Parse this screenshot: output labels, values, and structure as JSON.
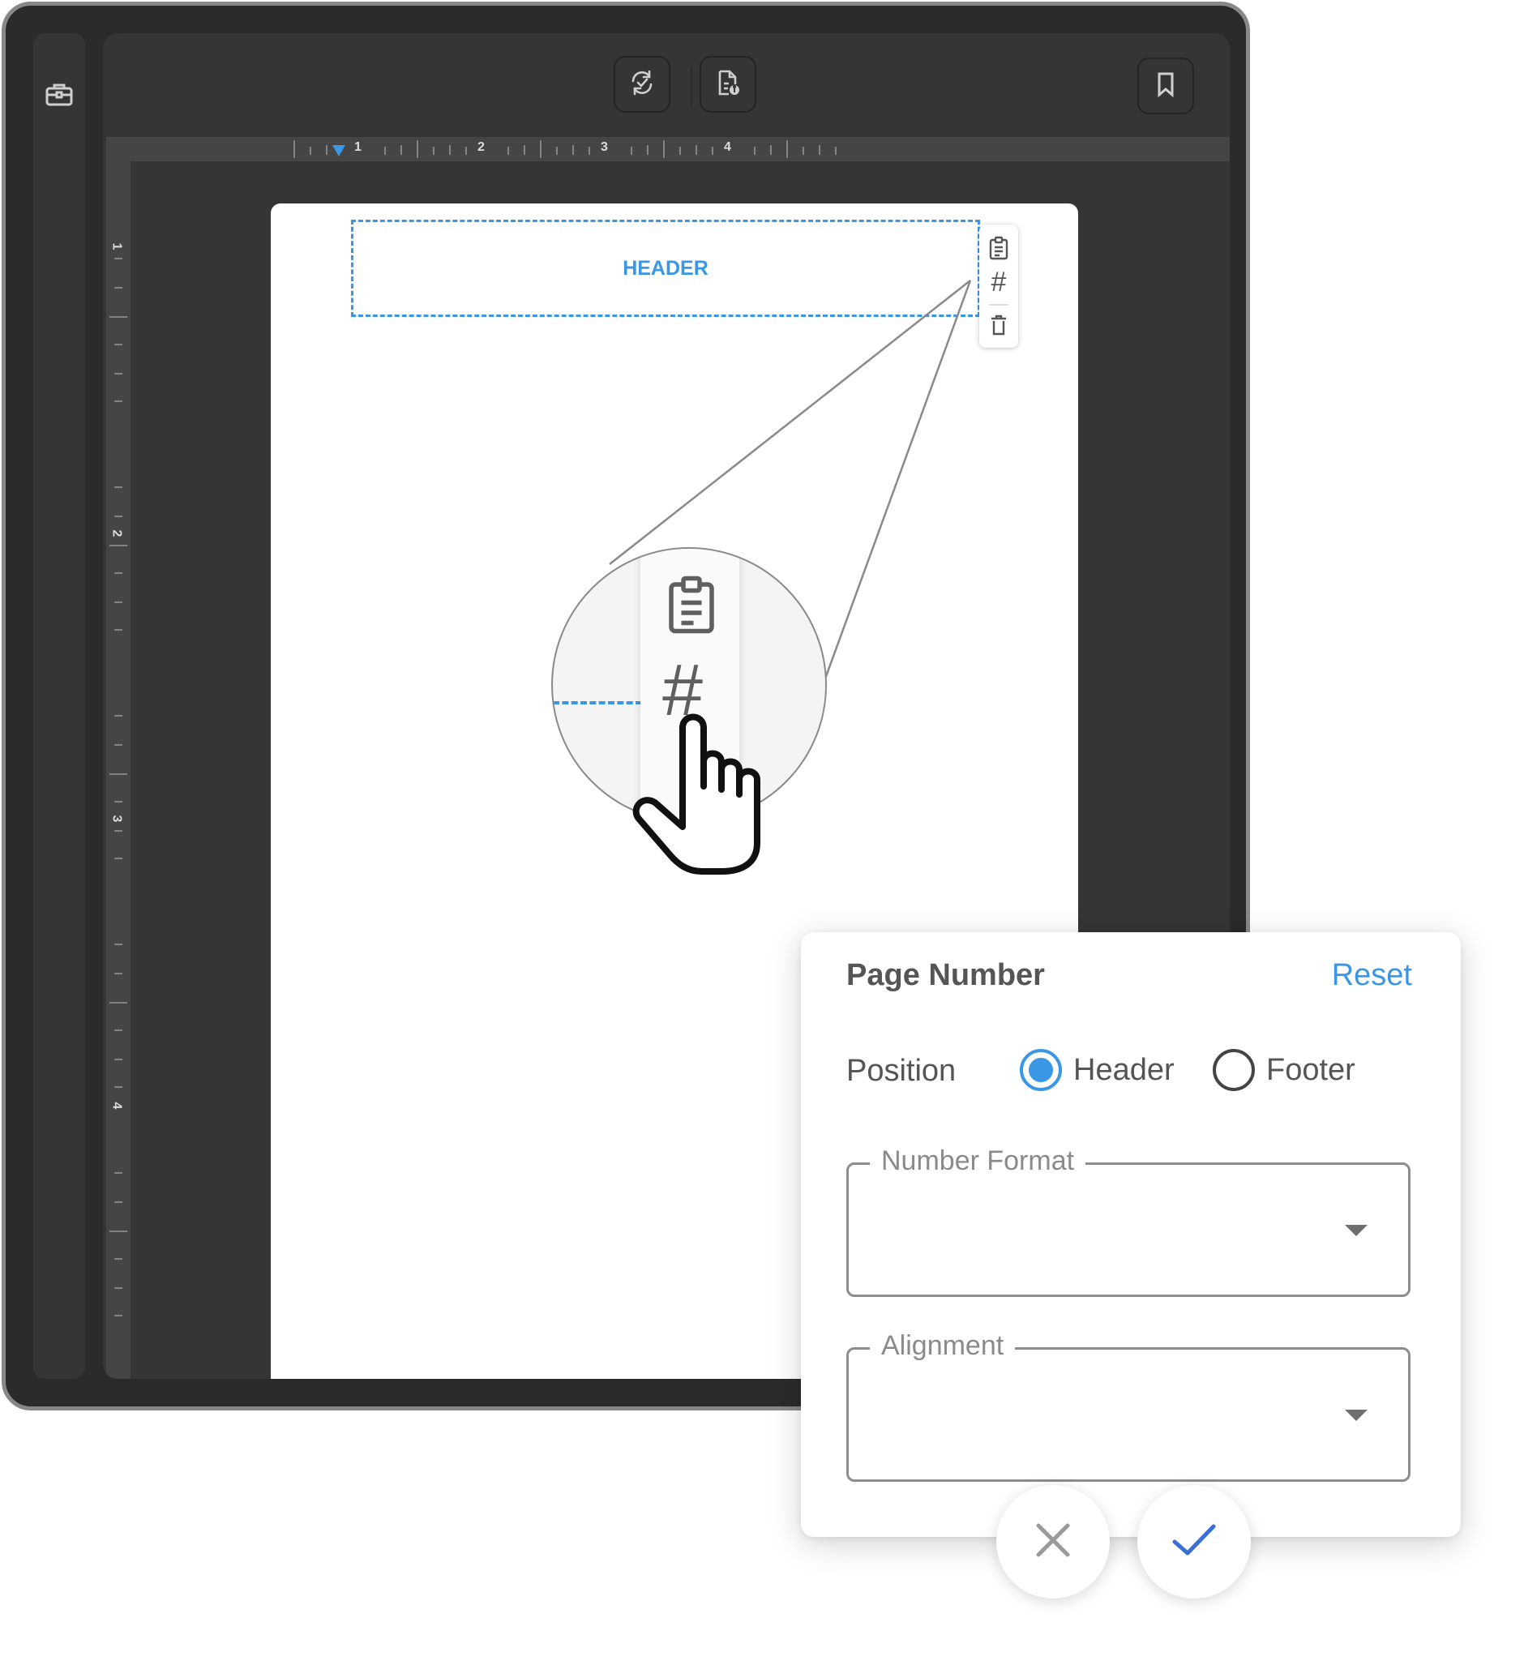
{
  "toolbar": {
    "left_icon": "toolbox-icon",
    "sync_icon": "sync-check-icon",
    "doc_info_icon": "document-info-icon",
    "bookmark_icon": "bookmark-icon"
  },
  "ruler": {
    "horizontal_numbers": [
      "1",
      "2",
      "3",
      "4"
    ],
    "vertical_numbers": [
      "1",
      "2",
      "3",
      "4"
    ]
  },
  "page": {
    "header_label": "HEADER",
    "header_tools": [
      "clipboard-icon",
      "hash-icon",
      "trash-icon"
    ],
    "hash_symbol": "#"
  },
  "dialog": {
    "title": "Page Number",
    "reset_label": "Reset",
    "position_label": "Position",
    "position_options": [
      {
        "label": "Header",
        "selected": true
      },
      {
        "label": "Footer",
        "selected": false
      }
    ],
    "number_format": {
      "label": "Number Format",
      "value": ""
    },
    "alignment": {
      "label": "Alignment",
      "value": ""
    },
    "cancel_icon": "close-icon",
    "confirm_icon": "check-icon"
  },
  "colors": {
    "accent": "#3a97e6",
    "window_bg": "#2b2b2b",
    "panel_bg": "#353535",
    "text": "#555555"
  }
}
